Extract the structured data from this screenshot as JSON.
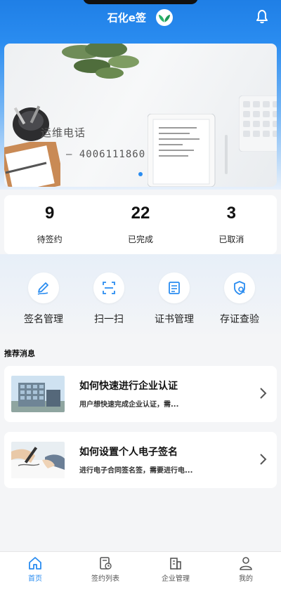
{
  "header": {
    "title": "石化e签"
  },
  "banner": {
    "text_line1": "运维电话",
    "text_line2": "— 4006111860"
  },
  "stats": [
    {
      "value": "9",
      "label": "待签约"
    },
    {
      "value": "22",
      "label": "已完成"
    },
    {
      "value": "3",
      "label": "已取消"
    }
  ],
  "actions": [
    {
      "label": "签名管理",
      "icon": "pen-icon"
    },
    {
      "label": "扫一扫",
      "icon": "scan-icon"
    },
    {
      "label": "证书管理",
      "icon": "certificate-icon"
    },
    {
      "label": "存证查验",
      "icon": "shield-check-icon"
    }
  ],
  "section": {
    "title": "推荐消息"
  },
  "messages": [
    {
      "title": "如何快速进行企业认证",
      "desc": "用户想快速完成企业认证，需..."
    },
    {
      "title": "如何设置个人电子签名",
      "desc": "进行电子合同签名签，需要进行电..."
    }
  ],
  "tabs": [
    {
      "label": "首页",
      "active": true
    },
    {
      "label": "签约列表"
    },
    {
      "label": "企业管理"
    },
    {
      "label": "我的"
    }
  ],
  "colors": {
    "primary": "#2a8cf0",
    "header_top": "#1f7fe6"
  }
}
